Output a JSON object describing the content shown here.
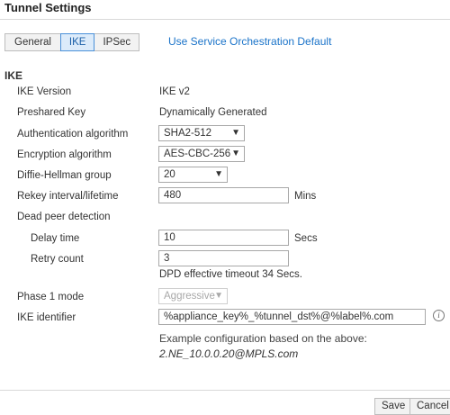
{
  "header": {
    "title": "Tunnel Settings"
  },
  "tabs": [
    {
      "label": "General"
    },
    {
      "label": "IKE"
    },
    {
      "label": "IPSec"
    }
  ],
  "orchestration_link": "Use Service Orchestration Default",
  "section": {
    "title": "IKE"
  },
  "fields": {
    "ike_version": {
      "label": "IKE Version",
      "value": "IKE v2"
    },
    "preshared_key": {
      "label": "Preshared Key",
      "value": "Dynamically Generated"
    },
    "auth_algorithm": {
      "label": "Authentication algorithm",
      "value": "SHA2-512"
    },
    "encryption_algorithm": {
      "label": "Encryption algorithm",
      "value": "AES-CBC-256"
    },
    "dh_group": {
      "label": "Diffie-Hellman group",
      "value": "20"
    },
    "rekey": {
      "label": "Rekey interval/lifetime",
      "value": "480",
      "unit": "Mins"
    },
    "dpd": {
      "label": "Dead peer detection"
    },
    "delay_time": {
      "label": "Delay time",
      "value": "10",
      "unit": "Secs"
    },
    "retry_count": {
      "label": "Retry count",
      "value": "3"
    },
    "dpd_note": "DPD effective timeout 34 Secs.",
    "phase1_mode": {
      "label": "Phase 1 mode",
      "value": "Aggressive"
    },
    "ike_identifier": {
      "label": "IKE identifier",
      "value": "%appliance_key%_%tunnel_dst%@%label%.com"
    },
    "example_text": "Example configuration based on the above:",
    "example_value": "2.NE_10.0.0.20@MPLS.com"
  },
  "footer": {
    "save_label": "Save",
    "cancel_label": "Cancel"
  },
  "colors": {
    "accent": "#1a73c9",
    "active_tab_bg": "#dcebfa",
    "active_tab_border": "#4a90d9"
  }
}
